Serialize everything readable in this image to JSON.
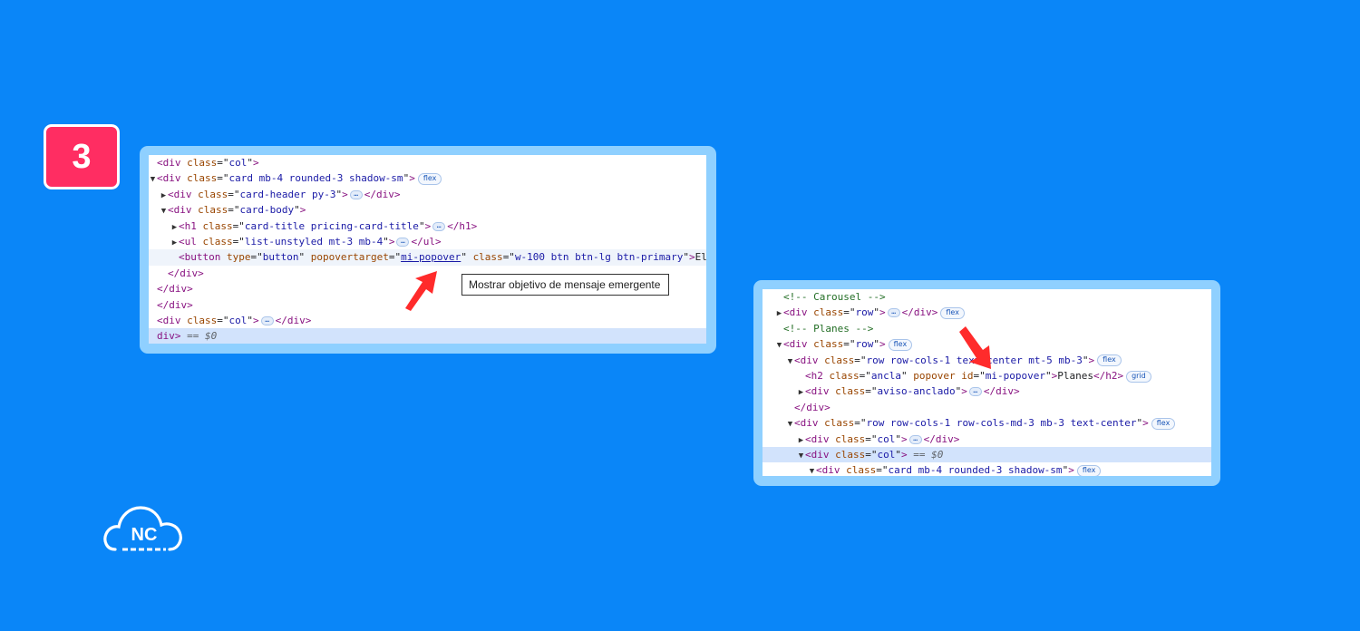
{
  "step": {
    "number": "3"
  },
  "colors": {
    "background": "#0A86F8",
    "badge": "#FF2D62",
    "panel_frame": "#8FD0FF",
    "arrow": "#FF2B2B"
  },
  "tooltip": {
    "text": "Mostrar objetivo de mensaje emergente"
  },
  "logo": {
    "text": "NC"
  },
  "panel_left": {
    "lines": [
      {
        "segments": [
          {
            "t": "<div ",
            "c": "tag"
          },
          {
            "t": "class",
            "c": "attr"
          },
          {
            "t": "=\"",
            "c": "txt"
          },
          {
            "t": "col",
            "c": "val"
          },
          {
            "t": "\"",
            "c": "txt"
          },
          {
            "t": ">",
            "c": "tag"
          }
        ]
      },
      {
        "segments": [
          {
            "t": "<div ",
            "c": "tag"
          },
          {
            "t": "class",
            "c": "attr"
          },
          {
            "t": "=\"",
            "c": "txt"
          },
          {
            "t": "card mb-4 rounded-3 shadow-sm",
            "c": "val"
          },
          {
            "t": "\"",
            "c": "txt"
          },
          {
            "t": ">",
            "c": "tag"
          }
        ]
      },
      {
        "segments": [
          {
            "t": "<div ",
            "c": "tag"
          },
          {
            "t": "class",
            "c": "attr"
          },
          {
            "t": "=\"",
            "c": "txt"
          },
          {
            "t": "card-header py-3",
            "c": "val"
          },
          {
            "t": "\"",
            "c": "txt"
          },
          {
            "t": ">",
            "c": "tag"
          }
        ],
        "tail": [
          {
            "t": "</div>",
            "c": "tag"
          }
        ]
      },
      {
        "segments": [
          {
            "t": "<div ",
            "c": "tag"
          },
          {
            "t": "class",
            "c": "attr"
          },
          {
            "t": "=\"",
            "c": "txt"
          },
          {
            "t": "card-body",
            "c": "val"
          },
          {
            "t": "\"",
            "c": "txt"
          },
          {
            "t": ">",
            "c": "tag"
          }
        ]
      },
      {
        "segments": [
          {
            "t": "<h1 ",
            "c": "tag"
          },
          {
            "t": "class",
            "c": "attr"
          },
          {
            "t": "=\"",
            "c": "txt"
          },
          {
            "t": "card-title pricing-card-title",
            "c": "val"
          },
          {
            "t": "\"",
            "c": "txt"
          },
          {
            "t": ">",
            "c": "tag"
          }
        ],
        "tail": [
          {
            "t": "</h1>",
            "c": "tag"
          }
        ]
      },
      {
        "segments": [
          {
            "t": "<ul ",
            "c": "tag"
          },
          {
            "t": "class",
            "c": "attr"
          },
          {
            "t": "=\"",
            "c": "txt"
          },
          {
            "t": "list-unstyled mt-3 mb-4",
            "c": "val"
          },
          {
            "t": "\"",
            "c": "txt"
          },
          {
            "t": ">",
            "c": "tag"
          }
        ],
        "tail": [
          {
            "t": "</ul>",
            "c": "tag"
          }
        ]
      },
      {
        "segments": [
          {
            "t": "<button ",
            "c": "tag"
          },
          {
            "t": "type",
            "c": "attr"
          },
          {
            "t": "=\"",
            "c": "txt"
          },
          {
            "t": "button",
            "c": "val"
          },
          {
            "t": "\" ",
            "c": "txt"
          },
          {
            "t": "popovertarget",
            "c": "attr"
          },
          {
            "t": "=\"",
            "c": "txt"
          },
          {
            "t": "mi-popover",
            "c": "link"
          },
          {
            "t": "\" ",
            "c": "txt"
          },
          {
            "t": "class",
            "c": "attr"
          },
          {
            "t": "=\"",
            "c": "txt"
          },
          {
            "t": "w-100 btn btn-lg btn-primary",
            "c": "val"
          },
          {
            "t": "\"",
            "c": "txt"
          },
          {
            "t": ">",
            "c": "tag"
          },
          {
            "t": "El",
            "c": "txt"
          }
        ]
      },
      {
        "segments": [
          {
            "t": "</div>",
            "c": "tag"
          }
        ]
      },
      {
        "segments": [
          {
            "t": "</div>",
            "c": "tag"
          }
        ]
      },
      {
        "segments": [
          {
            "t": "</div>",
            "c": "tag"
          }
        ]
      },
      {
        "segments": [
          {
            "t": "<div ",
            "c": "tag"
          },
          {
            "t": "class",
            "c": "attr"
          },
          {
            "t": "=\"",
            "c": "txt"
          },
          {
            "t": "col",
            "c": "val"
          },
          {
            "t": "\"",
            "c": "txt"
          },
          {
            "t": ">",
            "c": "tag"
          }
        ],
        "tail": [
          {
            "t": "</div>",
            "c": "tag"
          }
        ]
      },
      {
        "segments": [
          {
            "t": "div> ",
            "c": "tag"
          },
          {
            "t": "== $0",
            "c": "eq"
          }
        ]
      }
    ],
    "badges": [
      "flex"
    ]
  },
  "panel_right": {
    "lines": [
      {
        "segments": [
          {
            "t": "<!-- Carousel -->",
            "c": "cmt"
          }
        ]
      },
      {
        "segments": [
          {
            "t": "<div ",
            "c": "tag"
          },
          {
            "t": "class",
            "c": "attr"
          },
          {
            "t": "=\"",
            "c": "txt"
          },
          {
            "t": "row",
            "c": "val"
          },
          {
            "t": "\"",
            "c": "txt"
          },
          {
            "t": ">",
            "c": "tag"
          }
        ],
        "tail": [
          {
            "t": "</div>",
            "c": "tag"
          }
        ]
      },
      {
        "segments": [
          {
            "t": "<!-- Planes -->",
            "c": "cmt"
          }
        ]
      },
      {
        "segments": [
          {
            "t": "<div ",
            "c": "tag"
          },
          {
            "t": "class",
            "c": "attr"
          },
          {
            "t": "=\"",
            "c": "txt"
          },
          {
            "t": "row",
            "c": "val"
          },
          {
            "t": "\"",
            "c": "txt"
          },
          {
            "t": ">",
            "c": "tag"
          }
        ]
      },
      {
        "segments": [
          {
            "t": "<div ",
            "c": "tag"
          },
          {
            "t": "class",
            "c": "attr"
          },
          {
            "t": "=\"",
            "c": "txt"
          },
          {
            "t": "row row-cols-1 text-center mt-5 mb-3",
            "c": "val"
          },
          {
            "t": "\"",
            "c": "txt"
          },
          {
            "t": ">",
            "c": "tag"
          }
        ]
      },
      {
        "segments": [
          {
            "t": "<h2 ",
            "c": "tag"
          },
          {
            "t": "class",
            "c": "attr"
          },
          {
            "t": "=\"",
            "c": "txt"
          },
          {
            "t": "ancla",
            "c": "val"
          },
          {
            "t": "\" ",
            "c": "txt"
          },
          {
            "t": "popover ",
            "c": "attr"
          },
          {
            "t": "id",
            "c": "attr"
          },
          {
            "t": "=\"",
            "c": "txt"
          },
          {
            "t": "mi-popover",
            "c": "val"
          },
          {
            "t": "\"",
            "c": "txt"
          },
          {
            "t": ">",
            "c": "tag"
          },
          {
            "t": "Planes",
            "c": "txt"
          },
          {
            "t": "</h2>",
            "c": "tag"
          }
        ]
      },
      {
        "segments": [
          {
            "t": "<div ",
            "c": "tag"
          },
          {
            "t": "class",
            "c": "attr"
          },
          {
            "t": "=\"",
            "c": "txt"
          },
          {
            "t": "aviso-anclado",
            "c": "val"
          },
          {
            "t": "\"",
            "c": "txt"
          },
          {
            "t": ">",
            "c": "tag"
          }
        ],
        "tail": [
          {
            "t": "</div>",
            "c": "tag"
          }
        ]
      },
      {
        "segments": [
          {
            "t": "</div>",
            "c": "tag"
          }
        ]
      },
      {
        "segments": [
          {
            "t": "<div ",
            "c": "tag"
          },
          {
            "t": "class",
            "c": "attr"
          },
          {
            "t": "=\"",
            "c": "txt"
          },
          {
            "t": "row row-cols-1 row-cols-md-3 mb-3 text-center",
            "c": "val"
          },
          {
            "t": "\"",
            "c": "txt"
          },
          {
            "t": ">",
            "c": "tag"
          }
        ]
      },
      {
        "segments": [
          {
            "t": "<div ",
            "c": "tag"
          },
          {
            "t": "class",
            "c": "attr"
          },
          {
            "t": "=\"",
            "c": "txt"
          },
          {
            "t": "col",
            "c": "val"
          },
          {
            "t": "\"",
            "c": "txt"
          },
          {
            "t": ">",
            "c": "tag"
          }
        ],
        "tail": [
          {
            "t": "</div>",
            "c": "tag"
          }
        ]
      },
      {
        "segments": [
          {
            "t": "<div ",
            "c": "tag"
          },
          {
            "t": "class",
            "c": "attr"
          },
          {
            "t": "=\"",
            "c": "txt"
          },
          {
            "t": "col",
            "c": "val"
          },
          {
            "t": "\"",
            "c": "txt"
          },
          {
            "t": ">",
            "c": "tag"
          },
          {
            "t": " == $0",
            "c": "eq"
          }
        ]
      },
      {
        "segments": [
          {
            "t": "<div ",
            "c": "tag"
          },
          {
            "t": "class",
            "c": "attr"
          },
          {
            "t": "=\"",
            "c": "txt"
          },
          {
            "t": "card mb-4 rounded-3 shadow-sm",
            "c": "val"
          },
          {
            "t": "\"",
            "c": "txt"
          },
          {
            "t": ">",
            "c": "tag"
          }
        ]
      }
    ],
    "badges": [
      "flex",
      "grid"
    ]
  }
}
